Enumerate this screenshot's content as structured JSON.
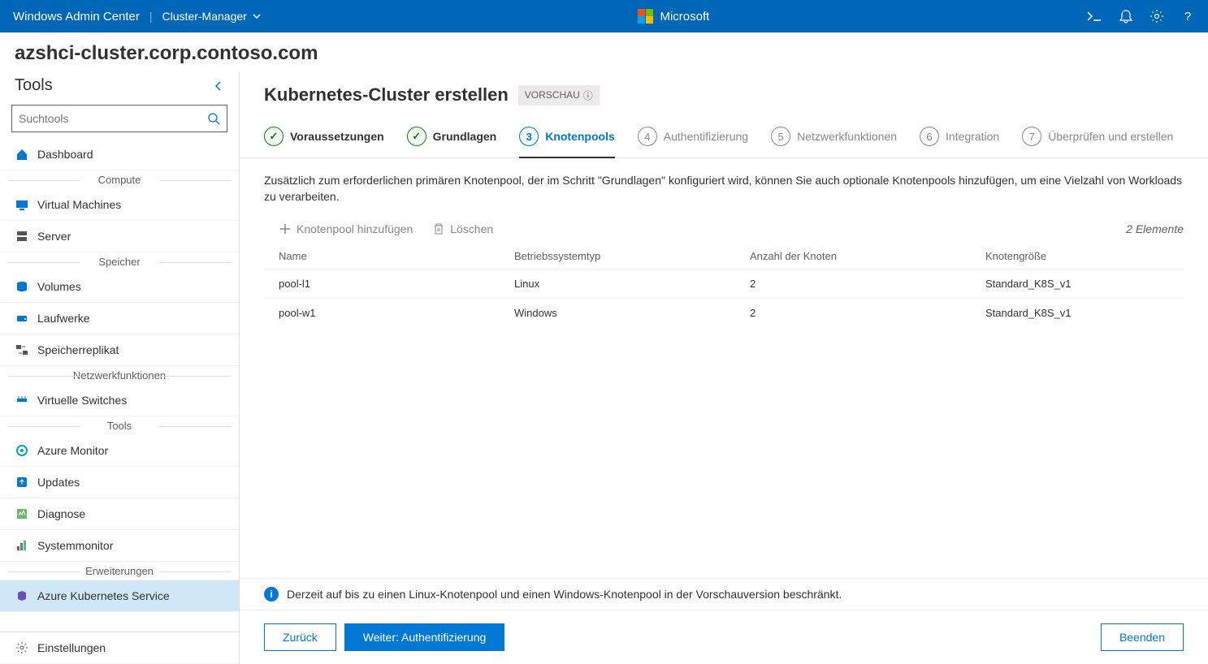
{
  "header": {
    "app_title": "Windows Admin Center",
    "context": "Cluster-Manager",
    "brand": "Microsoft"
  },
  "breadcrumb": "azshci-cluster.corp.contoso.com",
  "sidebar": {
    "title": "Tools",
    "search_placeholder": "Suchtools",
    "groups": {
      "compute": "Compute",
      "storage": "Speicher",
      "network": "Netzwerkfunktionen",
      "tools": "Tools",
      "extensions": "Erweiterungen"
    },
    "items": {
      "dashboard": "Dashboard",
      "vms": "Virtual Machines",
      "servers": "Server",
      "volumes": "Volumes",
      "drives": "Laufwerke",
      "replica": "Speicherreplikat",
      "vswitch": "Virtuelle Switches",
      "azmonitor": "Azure Monitor",
      "updates": "Updates",
      "diagnose": "Diagnose",
      "sysmon": "Systemmonitor",
      "aks": "Azure Kubernetes Service",
      "settings": "Einstellungen"
    }
  },
  "content": {
    "title": "Kubernetes-Cluster erstellen",
    "badge": "VORSCHAU",
    "steps": {
      "s1": "Voraussetzungen",
      "s2": "Grundlagen",
      "s3": "Knotenpools",
      "s4": "Authentifizierung",
      "s5": "Netzwerkfunktionen",
      "s6": "Integration",
      "s7": "Überprüfen und erstellen"
    },
    "description": "Zusätzlich zum erforderlichen primären Knotenpool, der im Schritt \"Grundlagen\" konfiguriert wird, können Sie auch optionale Knotenpools hinzufügen, um eine Vielzahl von Workloads zu verarbeiten.",
    "toolbar": {
      "add": "Knotenpool hinzufügen",
      "delete": "Löschen",
      "count": "2 Elemente"
    },
    "table": {
      "headers": {
        "name": "Name",
        "os": "Betriebssystemtyp",
        "count": "Anzahl der Knoten",
        "size": "Knotengröße"
      },
      "rows": [
        {
          "name": "pool-l1",
          "os": "Linux",
          "count": "2",
          "size": "Standard_K8S_v1"
        },
        {
          "name": "pool-w1",
          "os": "Windows",
          "count": "2",
          "size": "Standard_K8S_v1"
        }
      ]
    },
    "info": "Derzeit auf bis zu einen Linux-Knotenpool und einen Windows-Knotenpool in der Vorschauversion beschränkt.",
    "footer": {
      "back": "Zurück",
      "next": "Weiter: Authentifizierung",
      "exit": "Beenden"
    }
  }
}
